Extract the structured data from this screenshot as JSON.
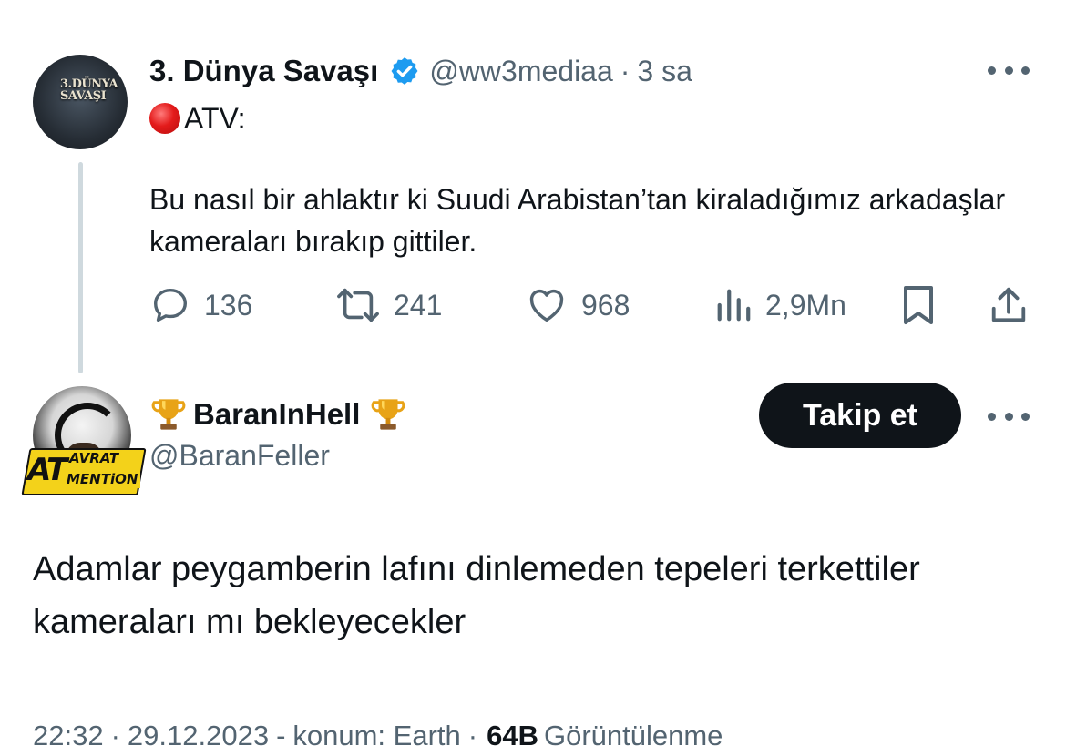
{
  "parent_tweet": {
    "author_name": "3. Dünya Savaşı",
    "avatar_text": "3.DÜNYA SAVAŞI",
    "handle": "@ww3mediaa",
    "separator": "·",
    "time": "3 sa",
    "source_label": "ATV:",
    "body": "Bu nasıl bir ahlaktır ki Suudi Arabistan’tan kiraladığımız arkadaşlar kameraları bırakıp gittiler.",
    "stats": {
      "replies": "136",
      "retweets": "241",
      "likes": "968",
      "views": "2,9Mn"
    }
  },
  "reply_tweet": {
    "author_name": "BaranInHell",
    "handle": "@BaranFeller",
    "follow_label": "Takip et",
    "avatar_badge": {
      "big": "AT",
      "top": "AVRAT",
      "bottom": "MENTiON"
    },
    "body": "Adamlar peygamberin lafını dinlemeden tepeleri terkettiler kameraları mı bekleyecekler",
    "footer": {
      "time": "22:32",
      "date": "29.12.2023",
      "location": "konum: Earth",
      "sep": "·",
      "views_count": "64B",
      "views_label": "Görüntülenme"
    }
  },
  "colors": {
    "text_primary": "#0f1419",
    "text_secondary": "#536471",
    "verified_blue": "#1d9bf0",
    "button_dark": "#0f1419",
    "thread_line": "#cfd9de"
  },
  "icons": [
    "more-icon",
    "verified-badge-icon",
    "red-circle-icon",
    "reply-icon",
    "retweet-icon",
    "like-icon",
    "views-icon",
    "bookmark-icon",
    "share-icon",
    "trophy-icon"
  ]
}
